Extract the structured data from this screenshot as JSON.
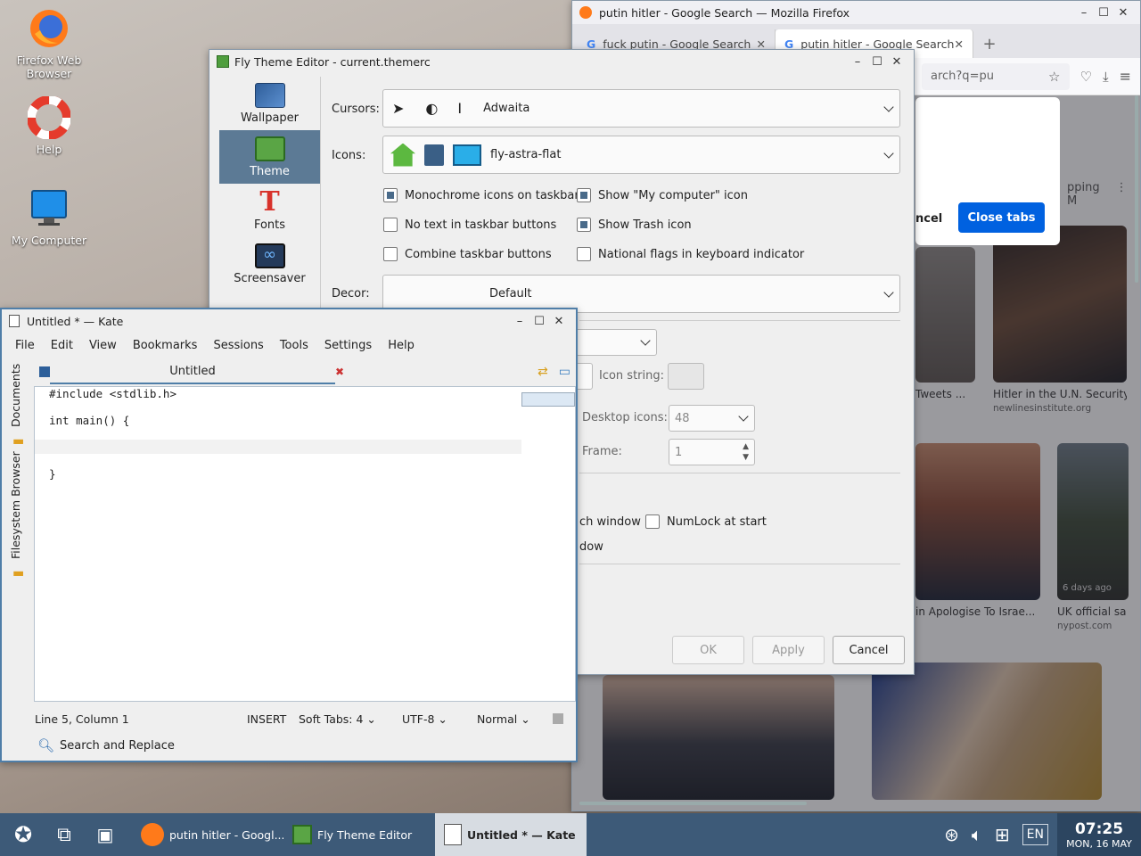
{
  "desktop": {
    "icons": [
      {
        "label_line1": "Firefox Web",
        "label_line2": "Browser"
      },
      {
        "label_line1": "Help",
        "label_line2": ""
      },
      {
        "label_line1": "My Computer",
        "label_line2": ""
      }
    ]
  },
  "firefox": {
    "title": "putin hitler - Google Search — Mozilla Firefox",
    "tabs": [
      {
        "label": "fuck putin - Google Search",
        "icon": "G"
      },
      {
        "label": "putin hitler - Google Search",
        "icon": "G"
      }
    ],
    "url_fragment": "arch?q=pu",
    "dialog": {
      "cancel_partial": "ncel",
      "close_tabs": "Close tabs"
    },
    "shopping_partial": "pping",
    "results": [
      {
        "caption": "Tweets ...",
        "source": ""
      },
      {
        "caption": "Hitler in the U.N. Security C",
        "source": "newlinesinstitute.org"
      },
      {
        "caption": "in Apologise To Israe...",
        "source": ""
      },
      {
        "caption": "UK official sa",
        "source": "nypost.com",
        "badge": "6 days ago"
      }
    ]
  },
  "theme_editor": {
    "title": "Fly Theme Editor - current.themerc",
    "sidebar": [
      "Wallpaper",
      "Theme",
      "Fonts",
      "Screensaver"
    ],
    "selected_sidebar": "Theme",
    "cursors_label": "Cursors:",
    "cursors_value": "Adwaita",
    "icons_label": "Icons:",
    "icons_value": "fly-astra-flat",
    "checkboxes": [
      {
        "label": "Monochrome icons on taskbar",
        "checked": true
      },
      {
        "label": "Show \"My computer\" icon",
        "checked": true
      },
      {
        "label": "No text in taskbar buttons",
        "checked": false
      },
      {
        "label": "Show Trash icon",
        "checked": true
      },
      {
        "label": "Combine taskbar buttons",
        "checked": false
      },
      {
        "label": "National flags in keyboard indicator",
        "checked": false
      }
    ],
    "decor_label": "Decor:",
    "decor_value": "Default",
    "icon_string_label": "Icon string:",
    "desktop_icons_label": "Desktop  icons:",
    "desktop_icons_value": "48",
    "frame_label": "Frame:",
    "frame_value": "1",
    "launch_window_partial": "ch window",
    "numlock_label": "NumLock at start",
    "window_partial": "dow",
    "buttons": {
      "ok": "OK",
      "apply": "Apply",
      "cancel": "Cancel"
    }
  },
  "kate": {
    "title": "Untitled * — Kate",
    "menu": [
      "File",
      "Edit",
      "View",
      "Bookmarks",
      "Sessions",
      "Tools",
      "Settings",
      "Help"
    ],
    "doc_tab": "Untitled",
    "side_tabs": [
      "Documents",
      "Filesystem Browser"
    ],
    "code_lines": [
      "#include <stdlib.h>",
      "",
      "int main() {",
      "",
      "",
      "}"
    ],
    "status": {
      "position": "Line 5, Column 1",
      "mode": "INSERT",
      "tabs": "Soft Tabs: 4",
      "encoding": "UTF-8",
      "syntax": "Normal"
    },
    "search_replace": "Search and Replace"
  },
  "taskbar": {
    "tasks": [
      {
        "label": "putin hitler - Googl..."
      },
      {
        "label": "Fly Theme Editor"
      },
      {
        "label": "Untitled * — Kate"
      }
    ],
    "language": "EN",
    "time": "07:25",
    "date": "MON, 16 MAY"
  }
}
